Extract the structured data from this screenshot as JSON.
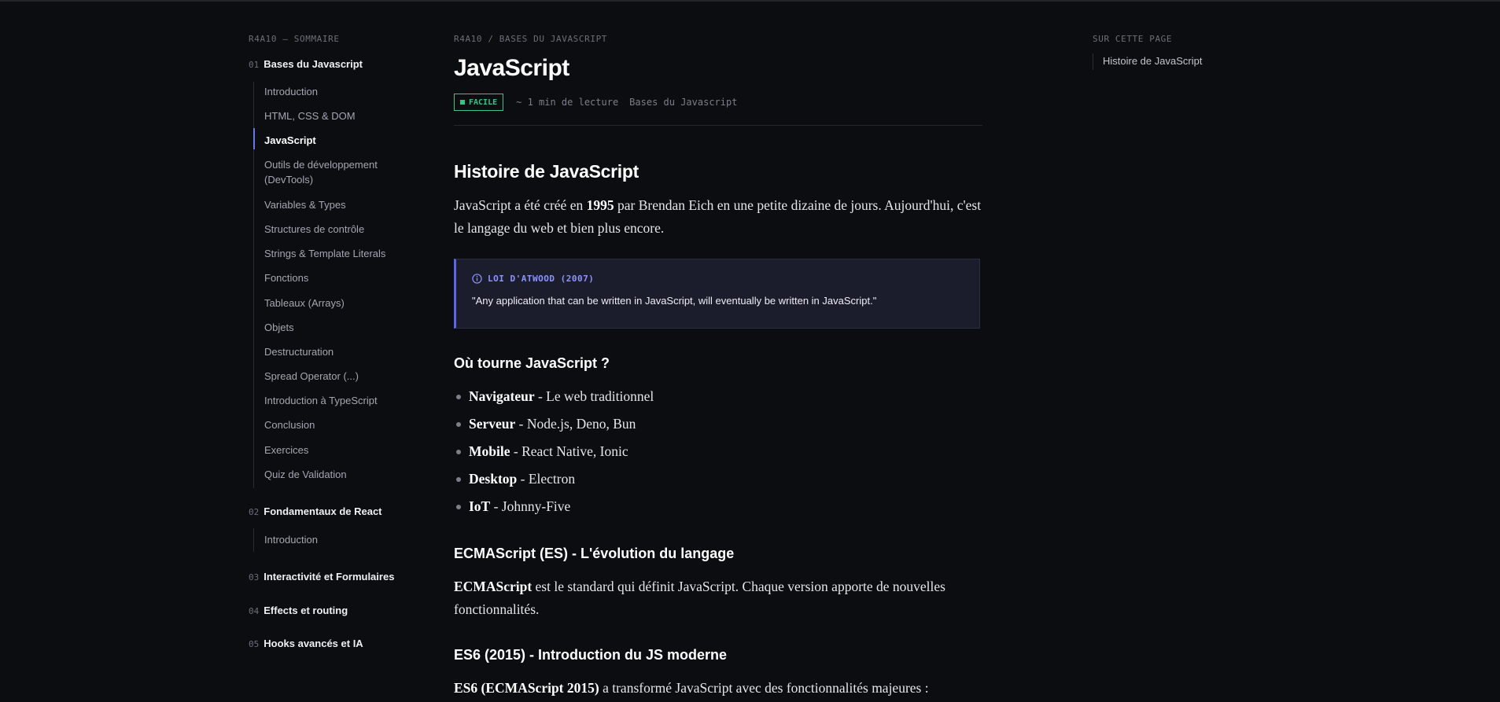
{
  "sidebar": {
    "heading": "R4A10 — SOMMAIRE",
    "sections": [
      {
        "number": "01",
        "title": "Bases du Javascript",
        "items": [
          "Introduction",
          "HTML, CSS & DOM",
          "JavaScript",
          "Outils de développement (DevTools)",
          "Variables & Types",
          "Structures de contrôle",
          "Strings & Template Literals",
          "Fonctions",
          "Tableaux (Arrays)",
          "Objets",
          "Destructuration",
          "Spread Operator (...)",
          "Introduction à TypeScript",
          "Conclusion",
          "Exercices",
          "Quiz de Validation"
        ],
        "active_item": "JavaScript"
      },
      {
        "number": "02",
        "title": "Fondamentaux de React",
        "items": [
          "Introduction"
        ]
      },
      {
        "number": "03",
        "title": "Interactivité et Formulaires"
      },
      {
        "number": "04",
        "title": "Effects et routing"
      },
      {
        "number": "05",
        "title": "Hooks avancés et IA"
      }
    ]
  },
  "main": {
    "breadcrumb": "R4A10 / BASES DU JAVASCRIPT",
    "title": "JavaScript",
    "badge": "FACILE",
    "reading_time": "~ 1 min de lecture",
    "category": "Bases du Javascript",
    "h2": "Histoire de JavaScript",
    "intro": {
      "part1": "JavaScript a été créé en ",
      "year": "1995",
      "part2": " par Brendan Eich en une petite dizaine de jours. Aujourd'hui, c'est le langage du web et bien plus encore."
    },
    "callout": {
      "title": "LOI D'ATWOOD (2007)",
      "body": "\"Any application that can be written in JavaScript, will eventually be written in JavaScript.\""
    },
    "h3_where": "Où tourne JavaScript ?",
    "platforms": [
      {
        "name": "Navigateur",
        "desc": " - Le web traditionnel"
      },
      {
        "name": "Serveur",
        "desc": " - Node.js, Deno, Bun"
      },
      {
        "name": "Mobile",
        "desc": " - React Native, Ionic"
      },
      {
        "name": "Desktop",
        "desc": " - Electron"
      },
      {
        "name": "IoT",
        "desc": " - Johnny-Five"
      }
    ],
    "h3_ecma": "ECMAScript (ES) - L'évolution du langage",
    "ecma_para": {
      "bold": "ECMAScript",
      "rest": " est le standard qui définit JavaScript. Chaque version apporte de nouvelles fonctionnalités."
    },
    "h3_es6": "ES6 (2015) - Introduction du JS moderne",
    "es6_para": {
      "bold": "ES6 (ECMAScript 2015)",
      "rest": " a transformé JavaScript avec des fonctionnalités majeures :"
    }
  },
  "toc": {
    "heading": "SUR CETTE PAGE",
    "items": [
      "Histoire de JavaScript"
    ]
  },
  "colors": {
    "background": "#0c0d11",
    "accent": "#6b74f0",
    "badge": "#34c387",
    "callout_bg": "#1b1d2c"
  }
}
